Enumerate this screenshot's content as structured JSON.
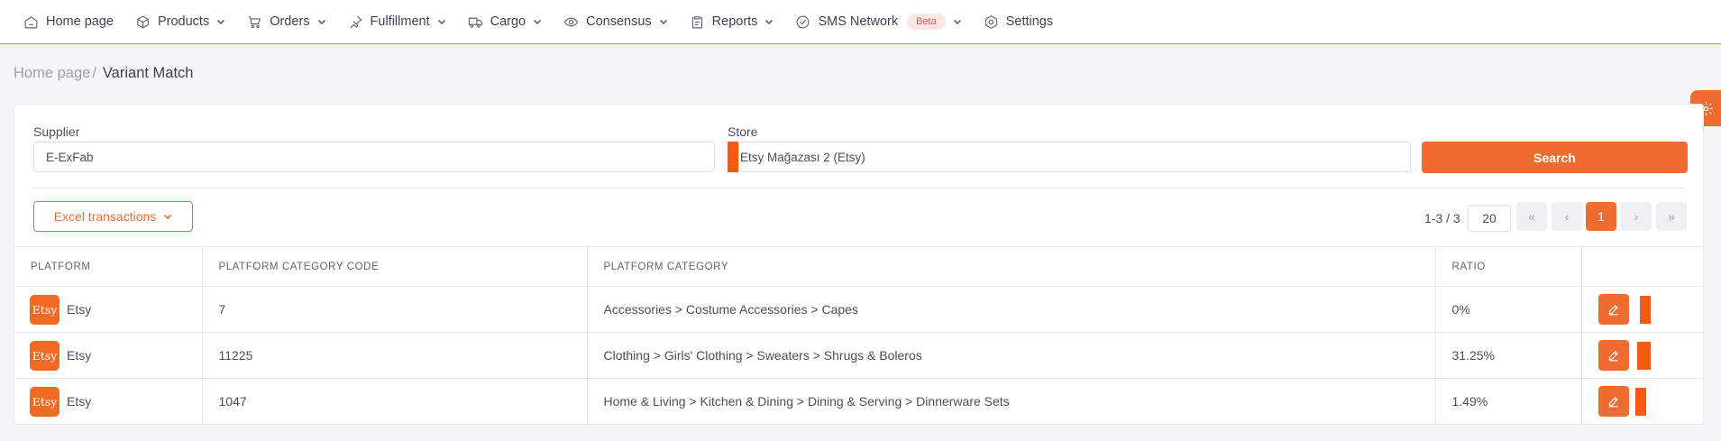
{
  "nav": {
    "items": [
      {
        "label": "Home page",
        "icon": "home-icon",
        "chevron": false
      },
      {
        "label": "Products",
        "icon": "cube-icon",
        "chevron": true
      },
      {
        "label": "Orders",
        "icon": "cart-icon",
        "chevron": true
      },
      {
        "label": "Fulfillment",
        "icon": "pin-icon",
        "chevron": true
      },
      {
        "label": "Cargo",
        "icon": "truck-icon",
        "chevron": true
      },
      {
        "label": "Consensus",
        "icon": "handshake-icon",
        "chevron": true
      },
      {
        "label": "Reports",
        "icon": "clipboard-icon",
        "chevron": true
      },
      {
        "label": "SMS Network",
        "icon": "check-circle-icon",
        "chevron": true,
        "badge": "Beta"
      },
      {
        "label": "Settings",
        "icon": "gear-icon",
        "chevron": false
      }
    ]
  },
  "breadcrumb": {
    "home": "Home page",
    "separator": "/",
    "current": "Variant Match"
  },
  "filters": {
    "supplier_label": "Supplier",
    "supplier_value": "E-ExFab",
    "store_label": "Store",
    "store_value": "Etsy Mağazası 2 (Etsy)",
    "search_label": "Search"
  },
  "toolbar": {
    "excel_label": "Excel transactions"
  },
  "pager": {
    "info": "1-3 / 3",
    "page_size": "20",
    "first": "«",
    "prev": "‹",
    "current": "1",
    "next": "›",
    "last": "»"
  },
  "table": {
    "headers": [
      "PLATFORM",
      "PLATFORM CATEGORY CODE",
      "PLATFORM CATEGORY",
      "RATIO",
      ""
    ],
    "logo_text": "Etsy",
    "rows": [
      {
        "platform": "Etsy",
        "code": "7",
        "category": "Accessories > Costume Accessories > Capes",
        "ratio": "0%"
      },
      {
        "platform": "Etsy",
        "code": "11225",
        "category": "Clothing > Girls' Clothing > Sweaters > Shrugs & Boleros",
        "ratio": "31.25%"
      },
      {
        "platform": "Etsy",
        "code": "1047",
        "category": "Home & Living > Kitchen & Dining > Dining & Serving > Dinnerware Sets",
        "ratio": "1.49%"
      }
    ]
  },
  "colors": {
    "accent": "#ef6c30",
    "marker": "#f45a14",
    "etsy": "#f06a22"
  }
}
